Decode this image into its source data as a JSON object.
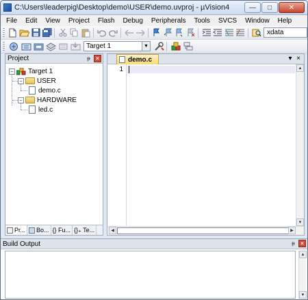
{
  "window": {
    "title": "C:\\Users\\leaderpig\\Desktop\\demo\\USER\\demo.uvproj - µVision4",
    "minimize_label": "—",
    "maximize_label": "□",
    "close_label": "✕"
  },
  "menubar": {
    "items": [
      "File",
      "Edit",
      "View",
      "Project",
      "Flash",
      "Debug",
      "Peripherals",
      "Tools",
      "SVCS",
      "Window",
      "Help"
    ]
  },
  "toolbar": {
    "find_value": "xdata",
    "target_value": "Target 1",
    "dropdown_arrow": "▼"
  },
  "project_panel": {
    "title": "Project",
    "pin": "ᵽ",
    "close": "×",
    "tree": {
      "target": "Target 1",
      "groups": [
        {
          "name": "USER",
          "files": [
            "demo.c"
          ]
        },
        {
          "name": "HARDWARE",
          "files": [
            "led.c"
          ]
        }
      ],
      "expand_symbol": "−"
    },
    "tabs": [
      "Pr...",
      "Bo...",
      "{} Fu...",
      "{}₊ Te..."
    ]
  },
  "editor": {
    "tab_label": "demo.c",
    "tab_menu": "▾",
    "tab_close": "×",
    "line_numbers": [
      "1"
    ],
    "scroll_up": "▲",
    "scroll_down": "▼",
    "scroll_left": "◀",
    "scroll_right": "▶"
  },
  "build_output": {
    "title": "Build Output",
    "pin": "ᵽ",
    "close": "×"
  },
  "colors": {
    "accent": "#3d7bd1",
    "tab_active": "#fbd97a",
    "close_red": "#d24b3a"
  }
}
